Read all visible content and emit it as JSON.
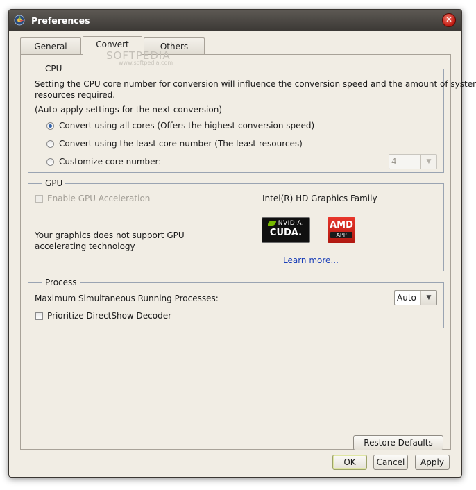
{
  "window": {
    "title": "Preferences",
    "close_glyph": "✕"
  },
  "tabs": [
    {
      "label": "General"
    },
    {
      "label": "Convert"
    },
    {
      "label": "Others"
    }
  ],
  "watermark": {
    "big": "SOFTPEDIA",
    "small": "www.softpedia.com"
  },
  "cpu": {
    "legend": "CPU",
    "description_line1": "Setting the CPU core number for conversion will influence the conversion speed and the amount of system",
    "description_line2": "resources required.",
    "auto_apply_note": "(Auto-apply settings for the next conversion)",
    "options": [
      {
        "label": "Convert using all cores (Offers the highest conversion speed)",
        "selected": true
      },
      {
        "label": "Convert using the least core number (The least resources)",
        "selected": false
      },
      {
        "label": "Customize core number:",
        "selected": false
      }
    ],
    "core_number_value": "4"
  },
  "gpu": {
    "legend": "GPU",
    "enable_label": "Enable GPU Acceleration",
    "enable_checked": false,
    "graphics_name": "Intel(R) HD Graphics Family",
    "unsupported_line1": "Your graphics does not support GPU",
    "unsupported_line2": "accelerating technology",
    "nvidia_logo": {
      "line1": "NVIDIA.",
      "line2": "CUDA."
    },
    "amd_logo": {
      "line1": "AMD",
      "line2": "APP"
    },
    "learn_more": "Learn more..."
  },
  "process": {
    "legend": "Process",
    "max_processes_label": "Maximum Simultaneous Running Processes:",
    "max_processes_value": "Auto",
    "prioritize_label": "Prioritize DirectShow Decoder",
    "prioritize_checked": false
  },
  "buttons": {
    "restore_defaults": "Restore Defaults",
    "ok": "OK",
    "cancel": "Cancel",
    "apply": "Apply"
  },
  "icons": {
    "app": "app-logo-icon",
    "dropdown": "▼"
  }
}
